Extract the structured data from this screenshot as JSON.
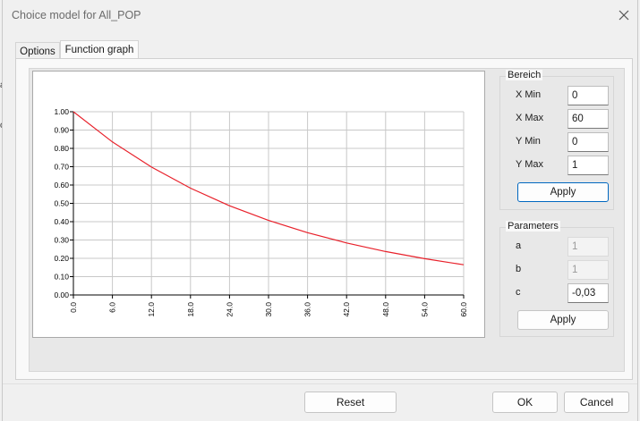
{
  "window": {
    "title": "Choice model for All_POP",
    "close_icon": "close-icon"
  },
  "tabs": [
    {
      "label": "Options"
    },
    {
      "label": "Function graph"
    }
  ],
  "background_fragments": {
    "left_top": "a",
    "left_bottom": "c"
  },
  "range_group": {
    "title": "Bereich",
    "fields": [
      {
        "label": "X Min",
        "value": "0"
      },
      {
        "label": "X Max",
        "value": "60"
      },
      {
        "label": "Y Min",
        "value": "0"
      },
      {
        "label": "Y Max",
        "value": "1"
      }
    ],
    "apply_label": "Apply"
  },
  "params_group": {
    "title": "Parameters",
    "fields": [
      {
        "label": "a",
        "value": "1",
        "disabled": true
      },
      {
        "label": "b",
        "value": "1",
        "disabled": true
      },
      {
        "label": "c",
        "value": "-0,03",
        "disabled": false
      }
    ],
    "apply_label": "Apply"
  },
  "footer": {
    "reset_label": "Reset",
    "ok_label": "OK",
    "cancel_label": "Cancel"
  },
  "chart_data": {
    "type": "line",
    "title": "",
    "xlabel": "",
    "ylabel": "",
    "xlim": [
      0,
      60
    ],
    "ylim": [
      0,
      1
    ],
    "grid": true,
    "x_ticks": [
      "0.0",
      "6.0",
      "12.0",
      "18.0",
      "24.0",
      "30.0",
      "36.0",
      "42.0",
      "48.0",
      "54.0",
      "60.0"
    ],
    "y_ticks": [
      "0.00",
      "0.10",
      "0.20",
      "0.30",
      "0.40",
      "0.50",
      "0.60",
      "0.70",
      "0.80",
      "0.90",
      "1.00"
    ],
    "series": [
      {
        "color": "#e8202a",
        "x": [
          0,
          6,
          12,
          18,
          24,
          30,
          36,
          42,
          48,
          54,
          60
        ],
        "y": [
          1.0,
          0.835,
          0.698,
          0.583,
          0.487,
          0.407,
          0.34,
          0.284,
          0.237,
          0.198,
          0.165
        ]
      }
    ]
  }
}
